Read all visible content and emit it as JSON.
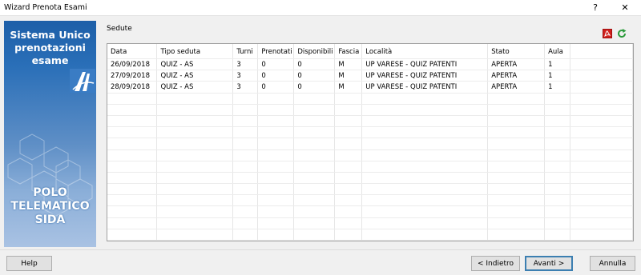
{
  "window": {
    "title": "Wizard Prenota Esami",
    "help_glyph": "?",
    "close_glyph": "✕"
  },
  "sidebar": {
    "title_lines": [
      "Sistema Unico",
      "prenotazioni",
      "esame"
    ],
    "subtitle_lines": [
      "POLO",
      "TELEMATICO",
      "SIDA"
    ]
  },
  "section": {
    "label": "Sedute"
  },
  "table": {
    "columns": [
      "Data",
      "Tipo seduta",
      "Turni",
      "Prenotati",
      "Disponibili",
      "Fascia",
      "Località",
      "Stato",
      "Aula"
    ],
    "rows": [
      [
        "26/09/2018",
        "QUIZ - AS",
        "3",
        "0",
        "0",
        "M",
        "UP VARESE - QUIZ PATENTI",
        "APERTA",
        "1"
      ],
      [
        "27/09/2018",
        "QUIZ - AS",
        "3",
        "0",
        "0",
        "M",
        "UP VARESE - QUIZ PATENTI",
        "APERTA",
        "1"
      ],
      [
        "28/09/2018",
        "QUIZ - AS",
        "3",
        "0",
        "0",
        "M",
        "UP VARESE - QUIZ PATENTI",
        "APERTA",
        "1"
      ]
    ]
  },
  "buttons": {
    "help": "Help",
    "back": "< Indietro",
    "next": "Avanti >",
    "cancel": "Annulla"
  },
  "colors": {
    "sidebar_top": "#1d5fa8",
    "pdf": "#d0201c",
    "refresh": "#2a9a3a"
  }
}
